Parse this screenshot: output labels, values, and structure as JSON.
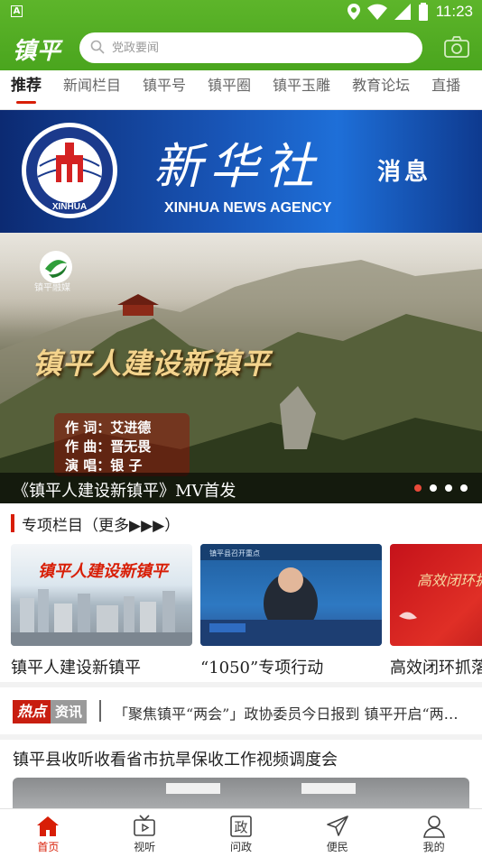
{
  "status_bar": {
    "time": "11:23",
    "notification_badge": "A"
  },
  "app": {
    "logo": "镇平",
    "search_placeholder": "党政要闻"
  },
  "tabs": [
    {
      "label": "推荐",
      "active": true
    },
    {
      "label": "新闻栏目"
    },
    {
      "label": "镇平号"
    },
    {
      "label": "镇平圈"
    },
    {
      "label": "镇平玉雕"
    },
    {
      "label": "教育论坛"
    },
    {
      "label": "直播"
    }
  ],
  "xinhua_banner": {
    "title": "新华社",
    "subtitle": "消息",
    "english": "XINHUA NEWS AGENCY",
    "emblem_text": "XINHUA"
  },
  "carousel": {
    "logo_text": "镇平融媒",
    "mv_title": "镇平人建设新镇平",
    "credits": [
      "作 词：艾进德",
      "作 曲：晋无畏",
      "演 唱：银  子"
    ],
    "caption": "《镇平人建设新镇平》MV首发",
    "dot_count": 4,
    "active_dot": 0
  },
  "special": {
    "title": "专项栏目（更多▶▶▶）",
    "cards": [
      {
        "label": "镇平人建设新镇平",
        "image_text": "镇平人建设新镇平"
      },
      {
        "label": "“1050”专项行动",
        "image_text": "镇平县召开重点"
      },
      {
        "label": "高效闭环抓落实",
        "image_text": "高效闭环抓落实"
      }
    ]
  },
  "hot_news": {
    "badge_a": "热点",
    "badge_b": "资讯",
    "text": "「聚焦镇平“两会”」政协委员今日报到 镇平开启“两会时间”"
  },
  "news": {
    "title": "镇平县收听收看省市抗旱保收工作视频调度会"
  },
  "bottom_nav": [
    {
      "label": "首页",
      "icon": "home-icon",
      "active": true
    },
    {
      "label": "视听",
      "icon": "tv-icon"
    },
    {
      "label": "问政",
      "icon": "zheng-icon",
      "glyph": "政"
    },
    {
      "label": "便民",
      "icon": "send-icon"
    },
    {
      "label": "我的",
      "icon": "person-icon"
    }
  ],
  "colors": {
    "brand_green": "#4aa51e",
    "accent_red": "#d81e06"
  }
}
